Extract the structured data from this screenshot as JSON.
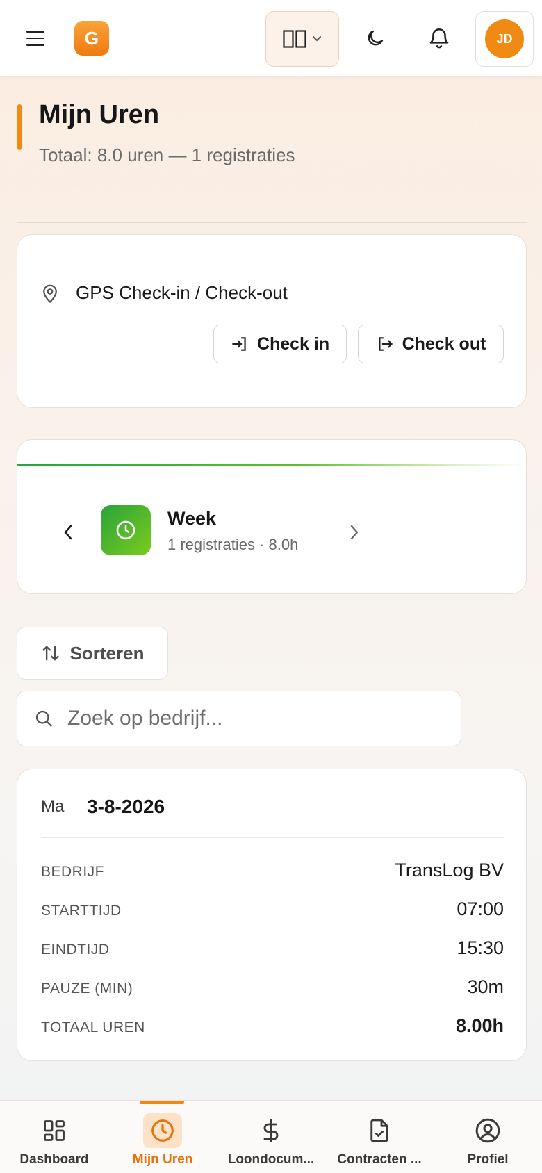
{
  "header": {
    "logo_letter": "G",
    "avatar_initials": "JD",
    "icons": {
      "menu": "hamburger-icon",
      "layout": "columns-icon",
      "theme": "moon-icon",
      "notifications": "bell-icon"
    }
  },
  "page": {
    "title": "Mijn Uren",
    "subtitle": "Totaal: 8.0 uren — 1 registraties"
  },
  "gps": {
    "label": "GPS Check-in / Check-out",
    "check_in": "Check in",
    "check_out": "Check out"
  },
  "week": {
    "title": "Week",
    "subtitle": "1 registraties · 8.0h"
  },
  "sort": {
    "label": "Sorteren"
  },
  "search": {
    "placeholder": "Zoek op bedrijf..."
  },
  "entry": {
    "day": "Ma",
    "date": "3-8-2026",
    "rows": [
      {
        "label": "BEDRIJF",
        "value": "TransLog BV"
      },
      {
        "label": "STARTTIJD",
        "value": "07:00"
      },
      {
        "label": "EINDTIJD",
        "value": "15:30"
      },
      {
        "label": "PAUZE (MIN)",
        "value": "30m"
      },
      {
        "label": "TOTAAL UREN",
        "value": "8.00h"
      }
    ]
  },
  "nav": {
    "items": [
      {
        "label": "Dashboard",
        "icon": "grid-icon"
      },
      {
        "label": "Mijn Uren",
        "icon": "clock-icon",
        "active": true
      },
      {
        "label": "Loondocum...",
        "icon": "dollar-icon"
      },
      {
        "label": "Contracten ...",
        "icon": "file-check-icon"
      },
      {
        "label": "Profiel",
        "icon": "user-icon"
      }
    ]
  },
  "colors": {
    "accent": "#f08a12",
    "week_gradient_start": "#2aa33a",
    "week_gradient_end": "#7bcb1e"
  }
}
